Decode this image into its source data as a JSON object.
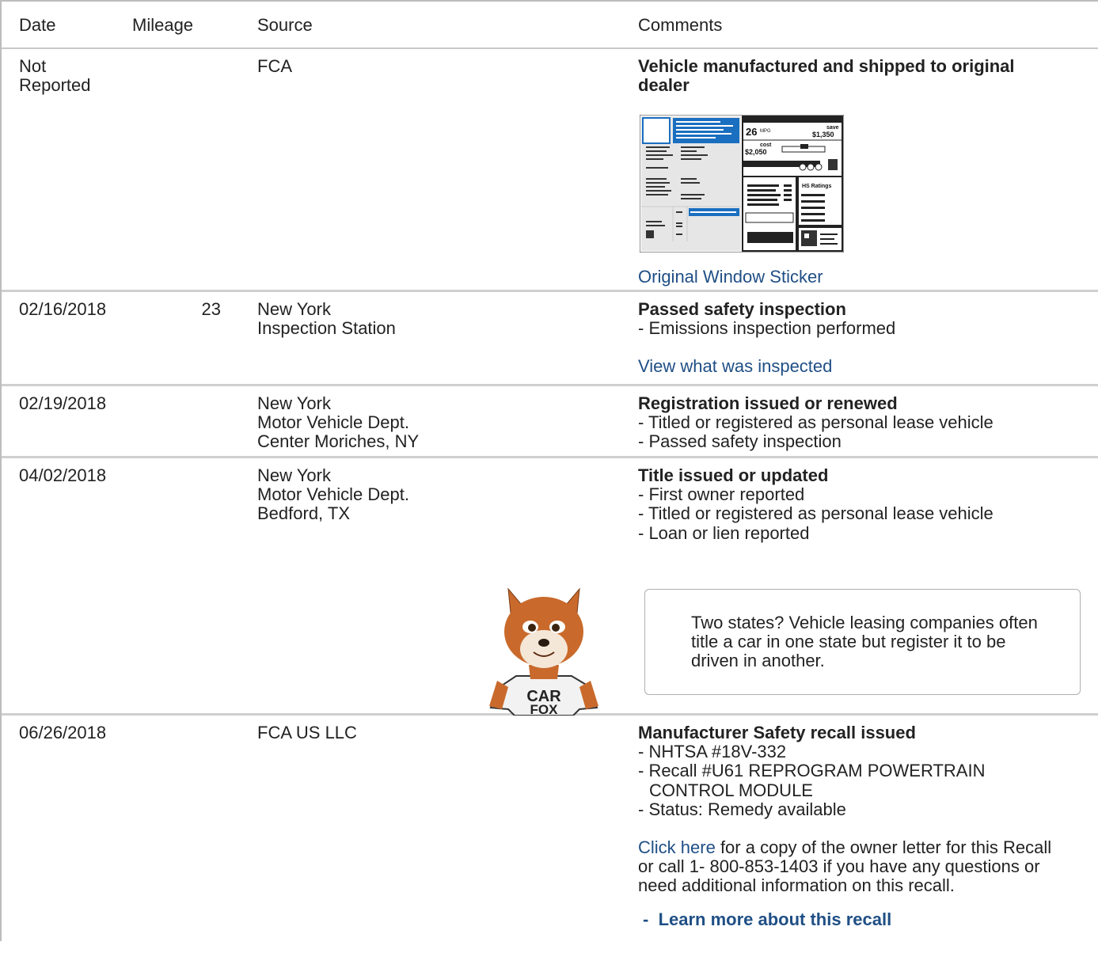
{
  "header": {
    "date": "Date",
    "mileage": "Mileage",
    "source": "Source",
    "comments": "Comments"
  },
  "rows": [
    {
      "date_lines": [
        "Not",
        "Reported"
      ],
      "mileage": "",
      "source_lines": [
        "FCA"
      ],
      "title": "Vehicle manufactured and shipped to original dealer",
      "link": "Original Window Sticker",
      "sticker": {
        "mpg": "26",
        "mpg_unit": "MPG",
        "save_label": "save",
        "save_amount": "$1,350",
        "cost_label": "cost",
        "cost_amount": "$2,050",
        "ratings": "HS Ratings"
      }
    },
    {
      "date": "02/16/2018",
      "mileage": "23",
      "source_lines": [
        "New York",
        "Inspection Station"
      ],
      "title": "Passed safety inspection",
      "details": [
        "- Emissions inspection performed"
      ],
      "link": "View what was inspected"
    },
    {
      "date": "02/19/2018",
      "mileage": "",
      "source_lines": [
        "New York",
        "Motor Vehicle Dept.",
        "Center Moriches, NY"
      ],
      "title": "Registration issued or renewed",
      "details": [
        "- Titled or registered as personal lease vehicle",
        "- Passed safety inspection"
      ]
    },
    {
      "date": "04/02/2018",
      "mileage": "",
      "source_lines": [
        "New York",
        "Motor Vehicle Dept.",
        "Bedford, TX"
      ],
      "title": "Title issued or updated",
      "details": [
        "- First owner reported",
        "- Titled or registered as personal lease vehicle",
        "- Loan or lien reported"
      ],
      "tip": "Two states? Vehicle leasing companies often title a car in one state but register it to be driven in another.",
      "fox_shirt": [
        "CAR",
        "FOX"
      ]
    },
    {
      "date": "06/26/2018",
      "mileage": "",
      "source_lines": [
        "FCA US LLC"
      ],
      "title": "Manufacturer Safety recall issued",
      "details": [
        "- NHTSA #18V-332",
        "- Recall #U61 REPROGRAM POWERTRAIN",
        "CONTROL MODULE",
        "- Status: Remedy available"
      ],
      "letter_link": "Click here",
      "letter_text": "for a copy of the owner letter for this Recall or call 1- 800-853-1403 if you have any questions or need additional information on this recall.",
      "learn_link": "Learn more about this recall"
    }
  ],
  "colors": {
    "link": "#1f4f85",
    "sticker_blue": "#1a6fc0",
    "border": "#cfcfcf"
  }
}
